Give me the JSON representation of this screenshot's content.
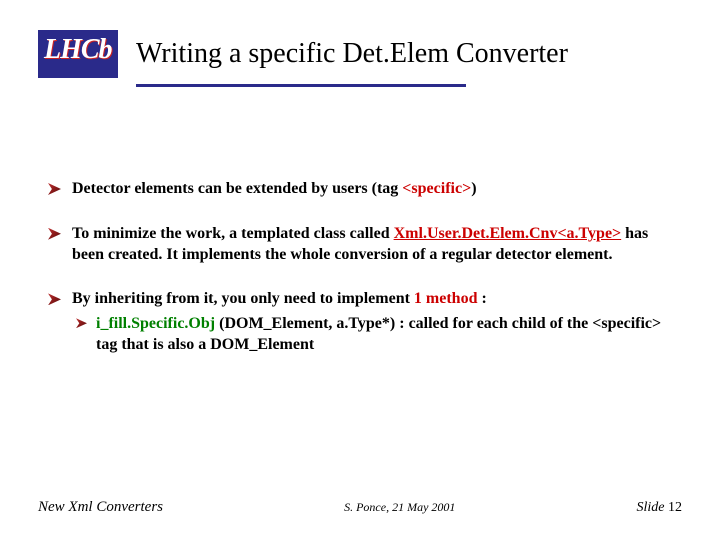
{
  "header": {
    "logo_text": "LHCb",
    "title": "Writing a specific Det.Elem Converter"
  },
  "bullets": [
    {
      "pre": "Detector elements can be extended by users (tag ",
      "tag": "<specific>",
      "post": ")"
    },
    {
      "pre": "To minimize the work, a templated class called ",
      "class": "Xml.User.Det.Elem.Cnv<a.Type>",
      "post": " has been created. It implements the whole conversion of a regular detector element."
    },
    {
      "pre": "By inheriting from it, you only need to implement ",
      "hl": "1 method",
      "post": " :",
      "sub": {
        "method": "i_fill.Specific.Obj",
        "sig": " (DOM_Element, a.Type*)",
        "post": " : called for each child of the <specific> tag that is also a DOM_Element"
      }
    }
  ],
  "footer": {
    "left": "New Xml Converters",
    "center": "S. Ponce,  21 May 2001",
    "right_label": "Slide ",
    "right_num": "12"
  }
}
